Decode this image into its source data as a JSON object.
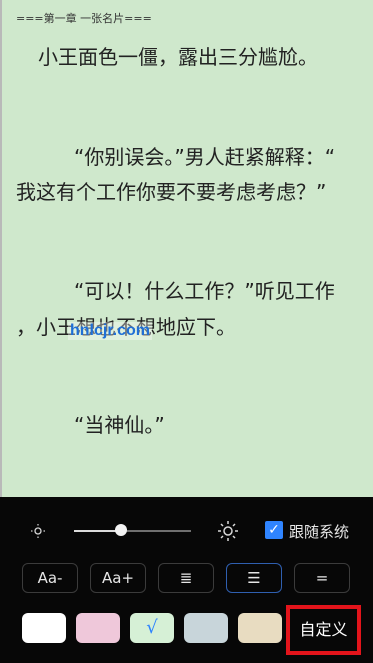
{
  "chapter_header": "===第一章 一张名片===",
  "paragraphs": [
    "小王面色一僵，露出三分尴尬。",
    "“你别误会。”男人赶紧解释：“",
    "我这有个工作你要不要考虑考虑？”",
    "“可以！什么工作？”听见工作",
    "，小王想也不想地应下。",
    "“当神仙。”"
  ],
  "watermark": "hnlcjr.com",
  "settings": {
    "brightness_level": 0.4,
    "follow_system_checked": true,
    "follow_system_label": "跟随系统",
    "buttons": [
      {
        "label": "Aa-"
      },
      {
        "label": "Aa+"
      },
      {
        "label": "≣"
      },
      {
        "label": "☰"
      },
      {
        "label": "="
      }
    ],
    "themes": [
      {
        "color": "#ffffff"
      },
      {
        "color": "#efc8da"
      },
      {
        "color": "#d6f0d6",
        "check": "√"
      },
      {
        "color": "#c8d5da"
      },
      {
        "color": "#e8dcc1"
      }
    ],
    "custom_label": "自定义"
  },
  "colors": {
    "page_background": "#cfe8cc",
    "panel_background": "#070707",
    "accent": "#2f84ff",
    "highlight_border": "#e3141b"
  }
}
